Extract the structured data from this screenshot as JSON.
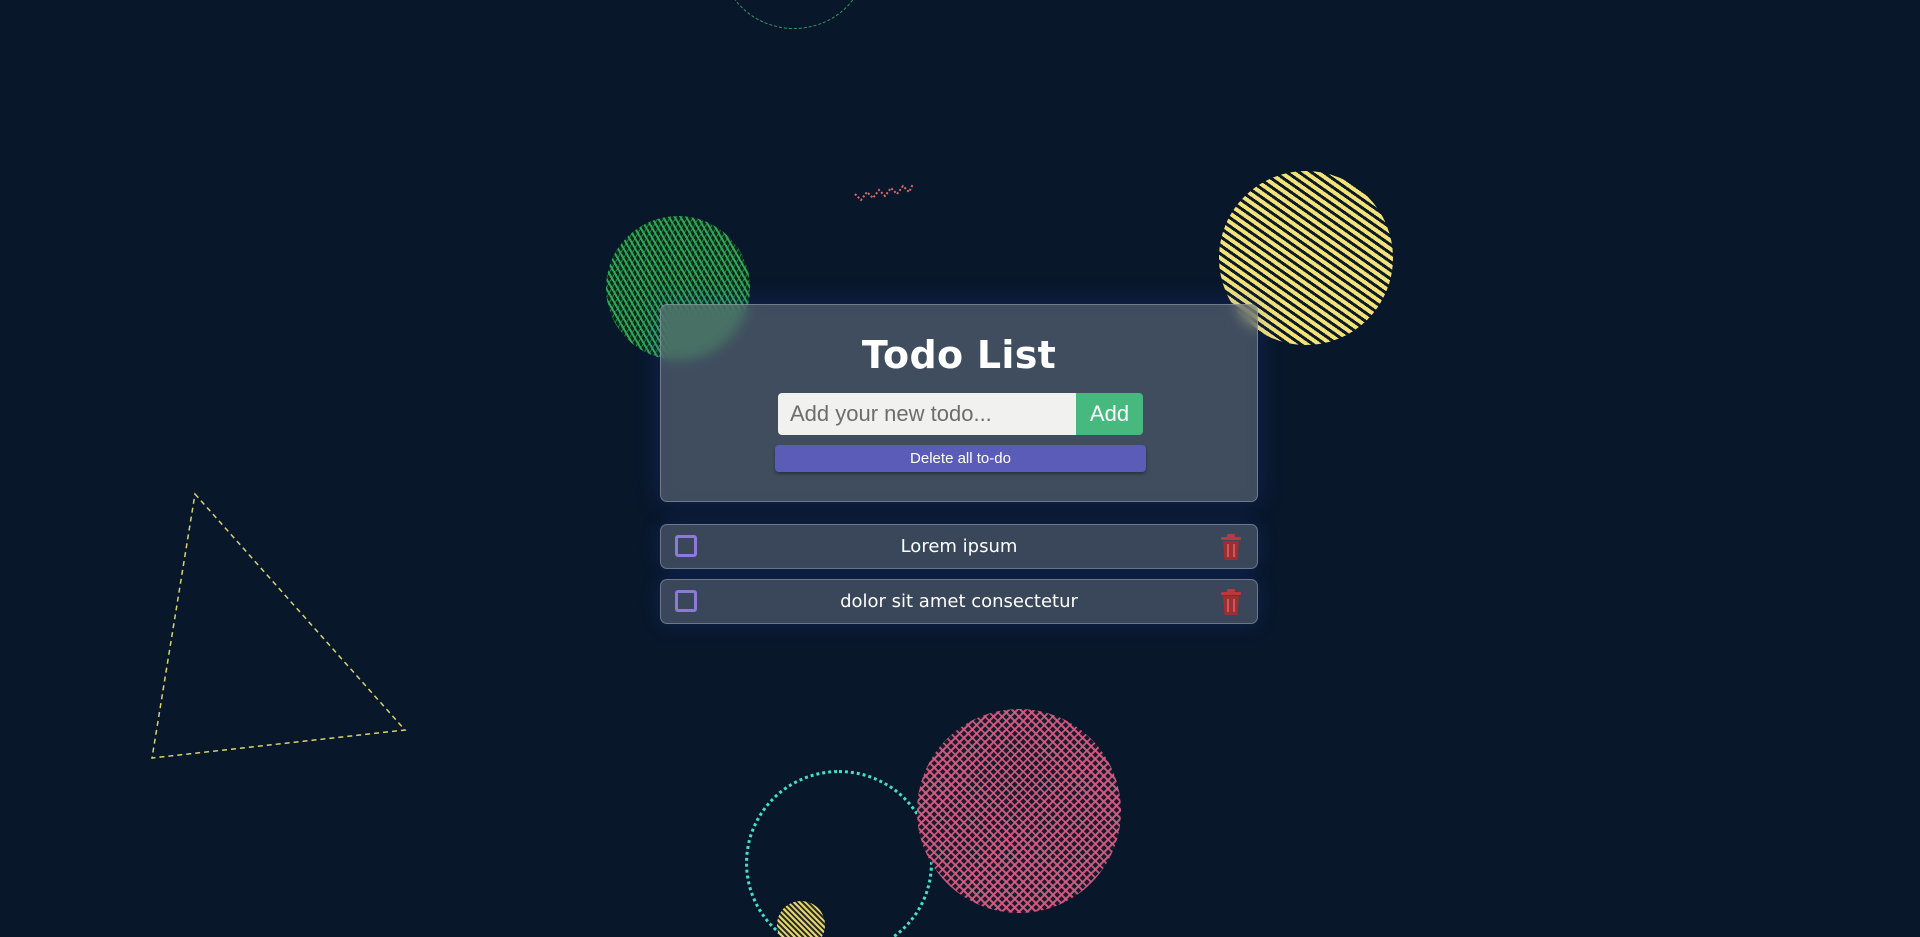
{
  "app": {
    "title": "Todo List"
  },
  "input": {
    "placeholder": "Add your new todo...",
    "value": ""
  },
  "buttons": {
    "add_label": "Add",
    "delete_all_label": "Delete all to-do"
  },
  "todos": [
    {
      "text": "Lorem ipsum",
      "done": false
    },
    {
      "text": "dolor sit amet consectetur",
      "done": false
    }
  ],
  "colors": {
    "background": "#08172a",
    "add_button": "#47b97f",
    "delete_all_button": "#5b5cb8",
    "checkbox": "#8d7ad6",
    "trash_icon": "#c44444"
  }
}
